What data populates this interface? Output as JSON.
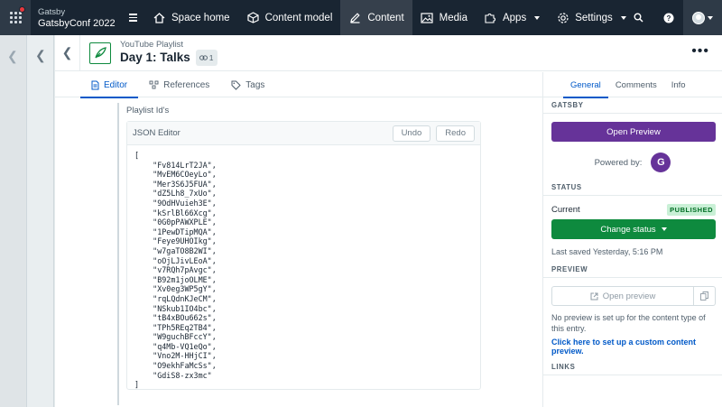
{
  "nav": {
    "org": "Gatsby",
    "space": "GatsbyConf 2022",
    "items": [
      {
        "label": "Space home",
        "active": false
      },
      {
        "label": "Content model",
        "active": false
      },
      {
        "label": "Content",
        "active": true
      },
      {
        "label": "Media",
        "active": false
      },
      {
        "label": "Apps",
        "active": false
      },
      {
        "label": "Settings",
        "active": false
      }
    ]
  },
  "entry": {
    "content_type": "YouTube Playlist",
    "title": "Day 1: Talks",
    "references": "1"
  },
  "tabs": [
    "Editor",
    "References",
    "Tags"
  ],
  "field": {
    "label": "Playlist Id's",
    "editor_label": "JSON Editor",
    "undo": "Undo",
    "redo": "Redo",
    "json": "[\n    \"Fv814LrT2JA\",\n    \"MvEM6COeyLo\",\n    \"Mer3S6J5FUA\",\n    \"dZ5Lh8_7xUo\",\n    \"9OdHVuieh3E\",\n    \"kSrlBl66Xcg\",\n    \"0G0pPAWXPLE\",\n    \"1PewDTipMQA\",\n    \"Feye9UHOIkg\",\n    \"w7gaTO8B2WI\",\n    \"oOjLJivLEoA\",\n    \"v7RQh7pAvgc\",\n    \"B92m1joOLME\",\n    \"Xv0eg3WP5gY\",\n    \"rqLQdnKJeCM\",\n    \"NSkub1IO4bc\",\n    \"tB4xBOu662s\",\n    \"TPh5REq2TB4\",\n    \"W9guchBFccY\",\n    \"q4Mb-VQ1eQo\",\n    \"Vno2M-HHjCI\",\n    \"O9ekhFaMcSs\",\n    \"GdiS8-zx3mc\"\n]"
  },
  "sidebar": {
    "tabs": [
      "General",
      "Comments",
      "Info"
    ],
    "gatsby_heading": "GATSBY",
    "open_preview_label": "Open Preview",
    "powered_by": "Powered by:",
    "status_heading": "STATUS",
    "current_label": "Current",
    "status_badge": "PUBLISHED",
    "change_status": "Change status",
    "last_saved": "Last saved Yesterday, 5:16 PM",
    "preview_heading": "PREVIEW",
    "open_preview_small": "Open preview",
    "no_preview_text": "No preview is set up for the content type of this entry.",
    "setup_link": "Click here to set up a custom content preview.",
    "links_heading": "LINKS"
  },
  "colors": {
    "nav_bg": "#192532",
    "accent_blue": "#0059c8",
    "gatsby_purple": "#663399",
    "publish_green": "#0e8a3e"
  }
}
